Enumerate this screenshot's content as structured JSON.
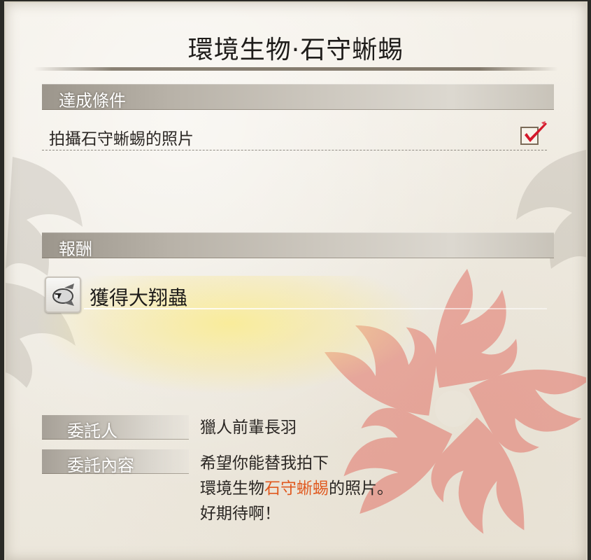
{
  "quest": {
    "title": "環境生物·石守蜥蜴"
  },
  "conditions": {
    "header": "達成條件",
    "items": [
      {
        "label": "拍攝石守蜥蜴的照片",
        "completed": true
      }
    ]
  },
  "rewards": {
    "header": "報酬",
    "items": [
      {
        "label": "獲得大翔蟲",
        "icon": "wirebug-icon"
      }
    ]
  },
  "client": {
    "label": "委託人",
    "value": "獵人前輩長羽"
  },
  "request": {
    "label": "委託內容",
    "line1": "希望你能替我拍下",
    "line2_prefix": "環境生物",
    "line2_highlight": "石守蜥蜴",
    "line2_suffix": "的照片。",
    "line3": "好期待啊！"
  },
  "colors": {
    "highlight": "#e0591f",
    "check": "#d4182a",
    "emblem": "#e27368"
  }
}
